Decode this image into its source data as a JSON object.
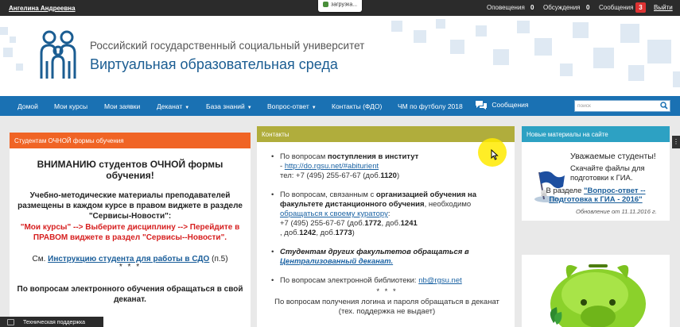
{
  "topbar": {
    "user": "Ангелина Андреевна",
    "loading": "загрузка...",
    "notifications_label": "Оповещения",
    "notifications_count": "0",
    "discussions_label": "Обсуждения",
    "discussions_count": "0",
    "messages_label": "Сообщения",
    "messages_count": "3",
    "logout": "Выйти"
  },
  "header": {
    "university": "Российский государственный социальный университет",
    "title": "Виртуальная образовательная среда"
  },
  "nav": {
    "items": [
      "Домой",
      "Мои курсы",
      "Мои заявки",
      "Деканат",
      "База знаний",
      "Вопрос-ответ",
      "Контакты (ФДО)",
      "ЧМ по футболу 2018",
      "Сообщения"
    ],
    "search_placeholder": "поиск"
  },
  "left_panel": {
    "heading": "Студентам ОЧНОЙ формы обучения",
    "attention": "ВНИМАНИЮ студентов ОЧНОЙ формы обучения!",
    "materials": "Учебно-методические материалы преподавателей размещены в каждом курсе в правом виджете в разделе \"Сервисы-Новости\":",
    "path": "\"Мои курсы\" --> Выберите дисциплину --> Перейдите в ПРАВОМ виджете в раздел \"Сервисы--Новости\".",
    "see_prefix": "См.",
    "see_link": "Инструкцию студента для работы в СДО",
    "see_suffix": "(п.5)",
    "stars": "* * *",
    "elearning": "По вопросам электронного обучения обращаться в свой деканат."
  },
  "center_panel": {
    "heading": "Контакты",
    "b1_prefix": "По вопросам",
    "b1_bold": "поступления в институт",
    "b1_dash": "-",
    "b1_link": "http://do.rgsu.net/#abiturient",
    "b1_tel_prefix": "тел: +7 (495) 255-67-67 (доб.",
    "b1_ext": "1120",
    "b1_tel_suffix": ")",
    "b2_prefix": "По вопросам, связанным с",
    "b2_bold": "организацией обучения на факультете дистанционного обучения",
    "b2_mid": ", необходимо",
    "b2_link": "обращаться к своему куратору",
    "b2_colon": ":",
    "b2_tel_prefix": "+7 (495) 255-67-67 (доб.",
    "b2_ext1": "1772",
    "b2_comma1": ", доб.",
    "b2_ext2": "1241",
    "b2_comma2": ", доб.",
    "b2_ext3": "1242",
    "b2_comma3": ", доб.",
    "b2_ext4": "1773",
    "b2_close": ")",
    "b3_bold": "Студентам других факультетов обращаться в",
    "b3_link": "Централизованный деканат.",
    "b4_prefix": "По вопросам электронной библиотеки:",
    "b4_link": "nb@rgsu.net",
    "stars": "* * *",
    "login_text": "По вопросам получения логина и пароля обращаться в деканат (тех. поддержка не выдает)"
  },
  "right_panel": {
    "heading": "Новые материалы на сайте",
    "greeting": "Уважаемые студенты!",
    "download": "Скачайте файлы для подготовки к ГИА.",
    "section_prefix": "В разделе",
    "section_link": "\"Вопрос-ответ -- Подготовка к ГИА - 2016\"",
    "updated": "Обновление от 11.11.2016 г."
  },
  "support": "Техническая поддержка",
  "colors": {
    "nav": "#1a71b3",
    "orange": "#f06425",
    "olive": "#b0ad3c",
    "teal": "#2da1c3",
    "badge": "#dd3333"
  }
}
